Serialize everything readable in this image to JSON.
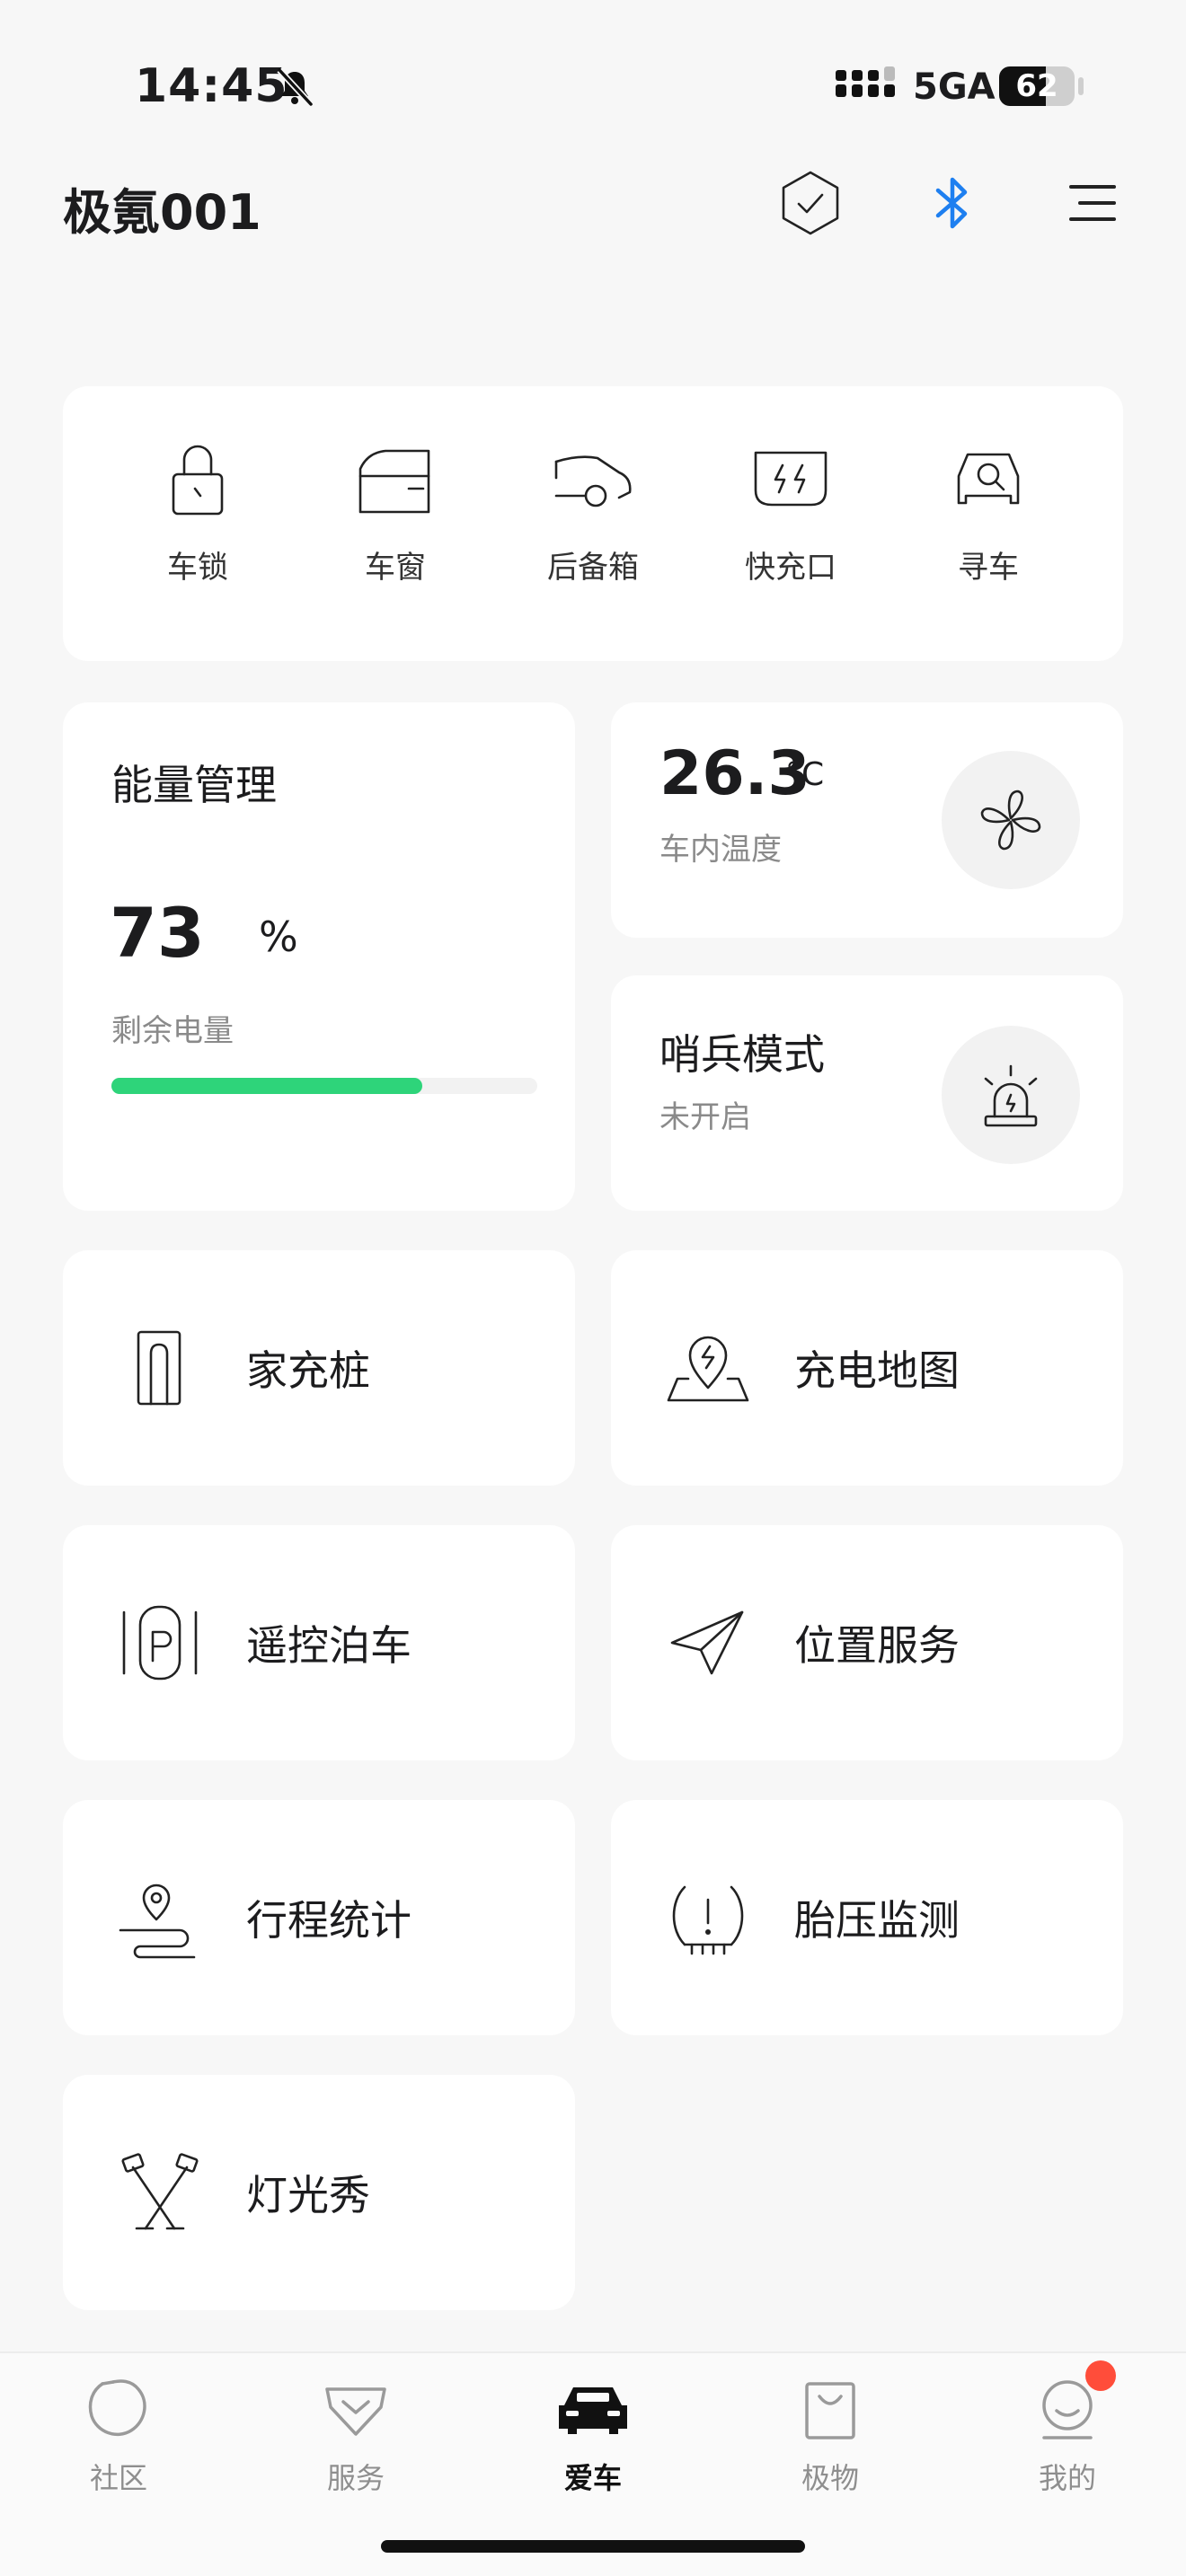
{
  "status_bar": {
    "time": "14:45",
    "network": "5GA",
    "battery": "62",
    "battery_level": 0.62
  },
  "header": {
    "title": "极氪001"
  },
  "quick_actions": [
    {
      "label": "车锁",
      "icon": "padlock-icon"
    },
    {
      "label": "车窗",
      "icon": "car-window-icon"
    },
    {
      "label": "后备箱",
      "icon": "trunk-icon"
    },
    {
      "label": "快充口",
      "icon": "fast-charge-port-icon"
    },
    {
      "label": "寻车",
      "icon": "find-car-icon"
    }
  ],
  "energy": {
    "title": "能量管理",
    "value": "73",
    "unit": "%",
    "label": "剩余电量",
    "level": 0.73,
    "bar_color": "#2ed47a"
  },
  "climate": {
    "value": "26.3",
    "unit": "°C",
    "label": "车内温度",
    "icon": "fan-icon"
  },
  "sentry": {
    "title": "哨兵模式",
    "status": "未开启",
    "icon": "alarm-light-icon"
  },
  "services": [
    {
      "label": "家充桩",
      "icon": "home-charger-icon"
    },
    {
      "label": "充电地图",
      "icon": "charging-map-icon"
    },
    {
      "label": "遥控泊车",
      "icon": "remote-parking-icon"
    },
    {
      "label": "位置服务",
      "icon": "send-location-icon"
    },
    {
      "label": "行程统计",
      "icon": "trip-route-icon"
    },
    {
      "label": "胎压监测",
      "icon": "tire-pressure-icon"
    },
    {
      "label": "灯光秀",
      "icon": "light-show-icon"
    }
  ],
  "tabbar": {
    "items": [
      {
        "label": "社区",
        "icon": "community-icon"
      },
      {
        "label": "服务",
        "icon": "service-icon"
      },
      {
        "label": "爱车",
        "icon": "car-icon"
      },
      {
        "label": "极物",
        "icon": "shopping-bag-icon"
      },
      {
        "label": "我的",
        "icon": "profile-icon"
      }
    ],
    "active_index": 2
  },
  "colors": {
    "accent_bluetooth": "#1e7ff0",
    "badge": "#ff4d3a",
    "energy_bar": "#2ed47a"
  }
}
